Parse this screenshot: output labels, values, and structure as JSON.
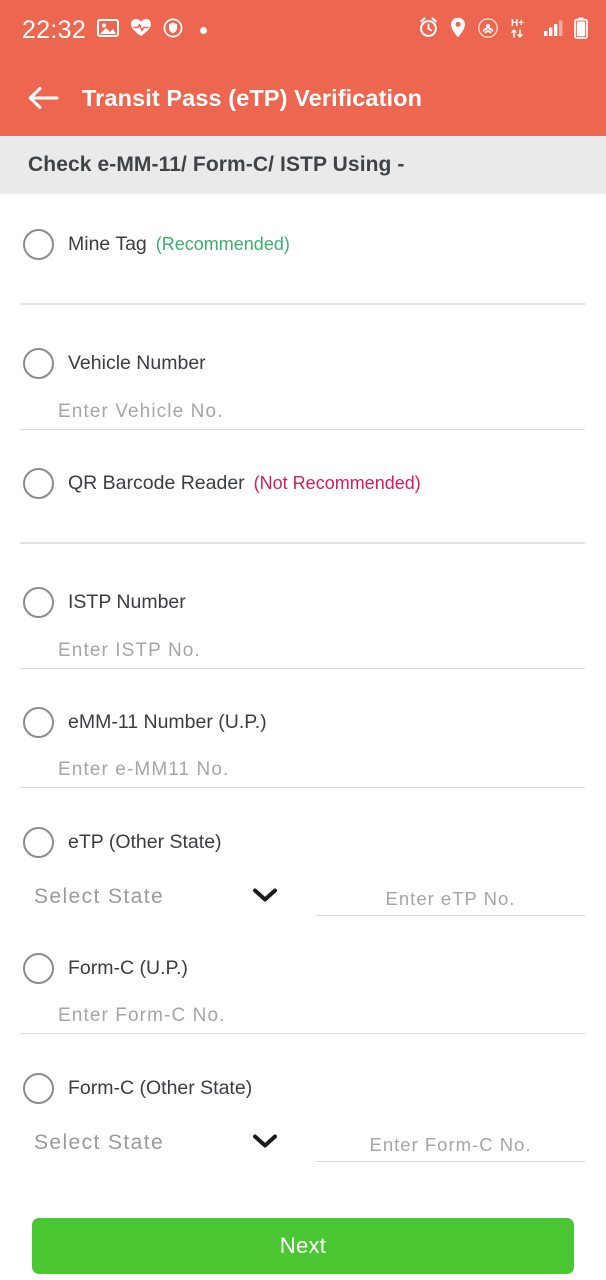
{
  "statusbar": {
    "time": "22:32",
    "left_icons": [
      "photo-icon",
      "heartbeat-icon",
      "shield-icon",
      "dot-indicator"
    ],
    "right_icons": [
      "alarm-icon",
      "location-pin-icon",
      "hotspot-icon",
      "hplus-data-icon",
      "signal-bars-icon",
      "battery-icon"
    ],
    "background_color": "#ec6650"
  },
  "appbar": {
    "back_label": "back-arrow",
    "title": "Transit Pass (eTP) Verification",
    "background_color": "#ec6650"
  },
  "section": {
    "heading": "Check e-MM-11/ Form-C/ ISTP Using -",
    "background_color": "#eaeaea"
  },
  "colors": {
    "accent": "#ec6650",
    "recommended": "#3faf6e",
    "not_recommended": "#d81b5c",
    "next_button": "#4cc734"
  },
  "options": [
    {
      "id": "mine-tag",
      "label": "Mine Tag",
      "note": "(Recommended)",
      "note_type": "good",
      "field": null
    },
    {
      "id": "vehicle-number",
      "label": "Vehicle Number",
      "note": "",
      "note_type": "",
      "field": {
        "placeholder": "Enter Vehicle No.",
        "value": ""
      }
    },
    {
      "id": "qr-barcode-reader",
      "label": "QR Barcode Reader",
      "note": "(Not Recommended)",
      "note_type": "bad",
      "field": null
    },
    {
      "id": "istp-number",
      "label": "ISTP Number",
      "note": "",
      "note_type": "",
      "field": {
        "placeholder": "Enter ISTP No.",
        "value": ""
      }
    },
    {
      "id": "emm11-number-up",
      "label": "eMM-11 Number (U.P.)",
      "note": "",
      "note_type": "",
      "field": {
        "placeholder": "Enter e-MM11 No.",
        "value": ""
      }
    },
    {
      "id": "etp-other-state",
      "label": "eTP (Other State)",
      "note": "",
      "note_type": "",
      "select": {
        "value": "Select State",
        "placeholder": "Select State"
      },
      "field": {
        "placeholder": "Enter eTP No.",
        "value": ""
      }
    },
    {
      "id": "form-c-up",
      "label": "Form-C (U.P.)",
      "note": "",
      "note_type": "",
      "field": {
        "placeholder": "Enter Form-C No.",
        "value": ""
      }
    },
    {
      "id": "form-c-other-state",
      "label": "Form-C (Other State)",
      "note": "",
      "note_type": "",
      "select": {
        "value": "Select State",
        "placeholder": "Select State"
      },
      "field": {
        "placeholder": "Enter Form-C No.",
        "value": ""
      }
    }
  ],
  "footer": {
    "next_label": "Next"
  }
}
